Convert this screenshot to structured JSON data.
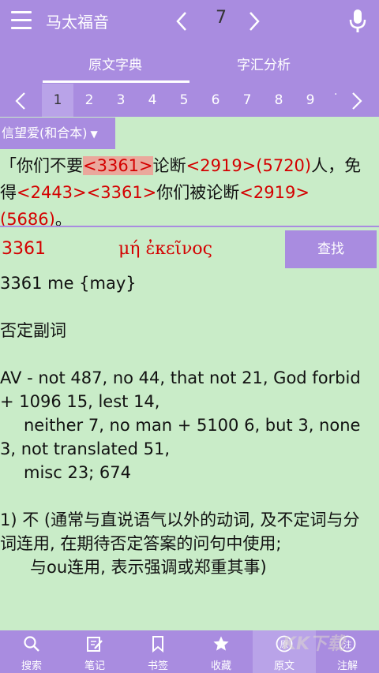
{
  "header": {
    "title": "马太福音",
    "chapter": "7"
  },
  "tabs": {
    "tab1": "原文字典",
    "tab2": "字汇分析"
  },
  "verse_nav": {
    "numbers": [
      "1",
      "2",
      "3",
      "4",
      "5",
      "6",
      "7",
      "8",
      "9"
    ],
    "selected": "1",
    "more": "·"
  },
  "version_picker": {
    "label": "信望爱(和合本)",
    "arrow": "▼"
  },
  "verse": {
    "p1": "「你们不要",
    "r1": "<3361>",
    "p2": "论断",
    "r2": "<2919>(5720)",
    "p3": "人，免得",
    "r3": "<2443><3361>",
    "p4": "你们被论断",
    "r4": "<2919>(5686)",
    "p5": "。"
  },
  "lookup": {
    "strong_number": "3361",
    "greek": "μή ἐκεῖνος",
    "find_button": "查找"
  },
  "definition": {
    "line1": "3361 me {may}",
    "line2": "否定副词",
    "line3": "AV - not 487, no 44, that not 21, God forbid + 1096 15, lest 14,",
    "line4": "neither 7, no man + 5100 6, but 3, none 3, not translated 51,",
    "line5": "misc 23; 674",
    "line6": "1) 不 (通常与直说语气以外的动词, 及不定词与分词连用, 在期待否定答案的问句中使用;",
    "line7": "与ou连用, 表示强调或郑重其事)"
  },
  "bottom_nav": {
    "search": "搜索",
    "notes": "笔记",
    "bookmarks": "书签",
    "favorites": "收藏",
    "original": "原文",
    "annotations": "注解"
  },
  "watermark": "KK下载",
  "colors": {
    "bar": "#a98ce0",
    "content_bg": "#c9ecc8",
    "ref_red": "#d40000",
    "highlight": "#eaa89c"
  }
}
